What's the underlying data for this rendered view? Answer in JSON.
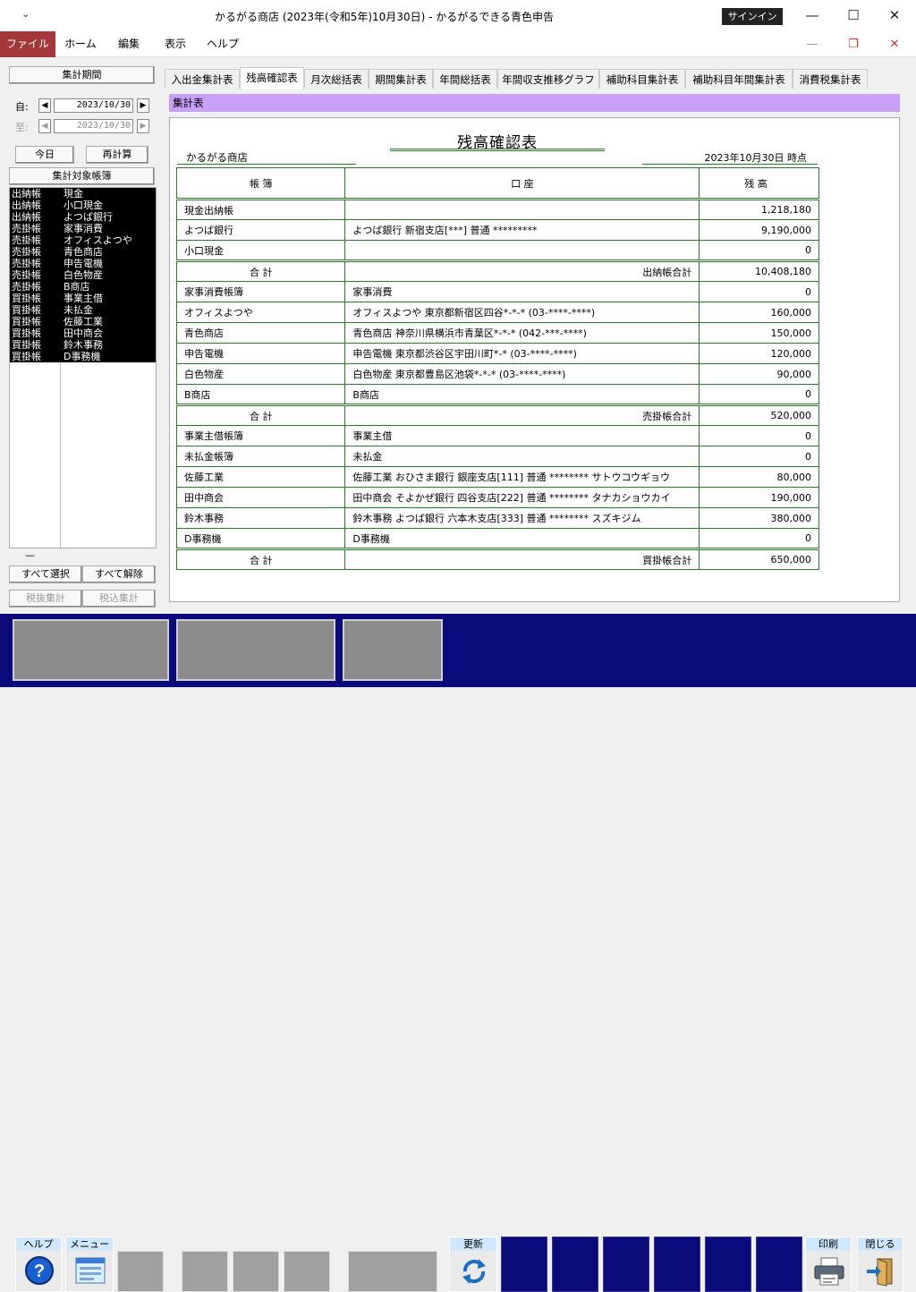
{
  "window": {
    "sysmenu": "₹",
    "title": "かるがる商店 (2023年(令和5年)10月30日)  -  かるがるできる青色申告",
    "signin": "サインイン",
    "minimize": "—",
    "maximize": "☐",
    "close": "✕"
  },
  "ribbon": {
    "tabs": [
      "ファイル",
      "ホーム",
      "編集",
      "表示",
      "ヘルプ"
    ],
    "min": "—",
    "restore": "❐",
    "close": "✕"
  },
  "left": {
    "period_header": "集計期間",
    "from_label": "自:",
    "to_label": "至:",
    "from_date": "2023/10/30",
    "to_date": "2023/10/30",
    "today": "今日",
    "recalc": "再計算",
    "target_header": "集計対象帳簿",
    "ledgers": [
      {
        "type": "出納帳",
        "name": "現金"
      },
      {
        "type": "出納帳",
        "name": "小口現金"
      },
      {
        "type": "出納帳",
        "name": "よつば銀行"
      },
      {
        "type": "売掛帳",
        "name": "家事消費"
      },
      {
        "type": "売掛帳",
        "name": "オフィスよつや"
      },
      {
        "type": "売掛帳",
        "name": "青色商店"
      },
      {
        "type": "売掛帳",
        "name": "申告電機"
      },
      {
        "type": "売掛帳",
        "name": "白色物産"
      },
      {
        "type": "売掛帳",
        "name": "B商店"
      },
      {
        "type": "買掛帳",
        "name": "事業主借"
      },
      {
        "type": "買掛帳",
        "name": "未払金"
      },
      {
        "type": "買掛帳",
        "name": "佐藤工業"
      },
      {
        "type": "買掛帳",
        "name": "田中商会"
      },
      {
        "type": "買掛帳",
        "name": "鈴木事務"
      },
      {
        "type": "買掛帳",
        "name": " D事務機"
      }
    ],
    "dash": "—",
    "select_all": "すべて選択",
    "deselect_all": "すべて解除",
    "tax_excl": "税抜集計",
    "tax_incl": "税込集計"
  },
  "tabs": [
    "入出金集計表",
    "残高確認表",
    "月次総括表",
    "期間集計表",
    "年間総括表",
    "年間収支推移グラフ",
    "補助科目集計表",
    "補助科目年間集計表",
    "消費税集計表"
  ],
  "active_tab": 1,
  "section_label": "集計表",
  "report": {
    "title": "残高確認表",
    "company": "かるがる商店",
    "as_of": "2023年10月30日 時点",
    "headers": [
      "帳 簿",
      "口 座",
      "残 高"
    ],
    "groups": [
      {
        "rows": [
          {
            "book": "現金出納帳",
            "account": "",
            "balance": "1,218,180"
          },
          {
            "book": "よつば銀行",
            "account": "よつば銀行 新宿支店[***] 普通 *********",
            "balance": "9,190,000"
          },
          {
            "book": "小口現金",
            "account": "",
            "balance": "0"
          }
        ],
        "total": {
          "label": "合 計",
          "kind": "出納帳合計",
          "amount": "10,408,180"
        }
      },
      {
        "rows": [
          {
            "book": "家事消費帳簿",
            "account": "家事消費",
            "balance": "0"
          },
          {
            "book": "オフィスよつや",
            "account": "オフィスよつや  東京都新宿区四谷*-*-* (03-****-****)",
            "balance": "160,000"
          },
          {
            "book": "青色商店",
            "account": "青色商店  神奈川県横浜市青葉区*-*-* (042-***-****)",
            "balance": "150,000"
          },
          {
            "book": "申告電機",
            "account": "申告電機  東京都渋谷区宇田川町*-* (03-****-****)",
            "balance": "120,000"
          },
          {
            "book": "白色物産",
            "account": "白色物産  東京都豊島区池袋*-*-* (03-****-****)",
            "balance": "90,000"
          },
          {
            "book": "B商店",
            "account": "B商店",
            "balance": "0"
          }
        ],
        "total": {
          "label": "合 計",
          "kind": "売掛帳合計",
          "amount": "520,000"
        }
      },
      {
        "rows": [
          {
            "book": "事業主借帳簿",
            "account": "事業主借",
            "balance": "0"
          },
          {
            "book": "未払金帳簿",
            "account": "未払金",
            "balance": "0"
          },
          {
            "book": "佐藤工業",
            "account": "佐藤工業  おひさま銀行 銀座支店[111] 普通 ******** サトウコウギョウ",
            "balance": "80,000"
          },
          {
            "book": "田中商会",
            "account": "田中商会  そよかぜ銀行 四谷支店[222] 普通 ******** タナカショウカイ",
            "balance": "190,000"
          },
          {
            "book": "鈴木事務",
            "account": "鈴木事務  よつば銀行 六本木支店[333] 普通 ******** スズキジム",
            "balance": "380,000"
          },
          {
            "book": " D事務機",
            "account": " D事務機",
            "balance": "0"
          }
        ],
        "total": {
          "label": "合 計",
          "kind": "買掛帳合計",
          "amount": "650,000"
        }
      }
    ]
  },
  "toolbar": {
    "help": "ヘルプ",
    "menu": "メニュー",
    "update": "更新",
    "print": "印刷",
    "close": "閉じる"
  }
}
